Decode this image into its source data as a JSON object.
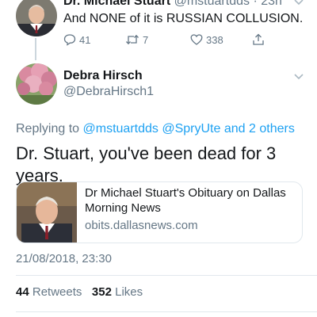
{
  "parent_tweet": {
    "author_name": "Dr. Michael Stuart",
    "author_handle": "@mstuartdds · 23h",
    "text": "And NONE of it is RUSSIAN COLLUSION.",
    "replies": "41",
    "retweets": "7",
    "likes": "338",
    "icons": [
      "reply-icon",
      "retweet-icon",
      "heart-icon",
      "share-icon"
    ]
  },
  "reply_tweet": {
    "author_name": "Debra Hirsch",
    "author_handle": "@DebraHirsch1",
    "replying_prefix": "Replying to",
    "replying_mention_1": "@mstuartdds",
    "replying_mention_2": "@SpryUte",
    "replying_and": "and",
    "replying_others": "2 others",
    "text": "Dr. Stuart, you've been dead for 3 years.",
    "link_card": {
      "title": "Dr Michael Stuart's Obituary on Dallas Morning News",
      "domain": "obits.dallasnews.com"
    },
    "timestamp": "21/08/2018, 23:30",
    "retweets_count": "44",
    "retweets_label": "Retweets",
    "likes_count": "352",
    "likes_label": "Likes"
  },
  "colors": {
    "link": "#1da1f2",
    "secondary_text": "#657786",
    "primary_text": "#14171a",
    "divider": "#e1e8ed"
  }
}
